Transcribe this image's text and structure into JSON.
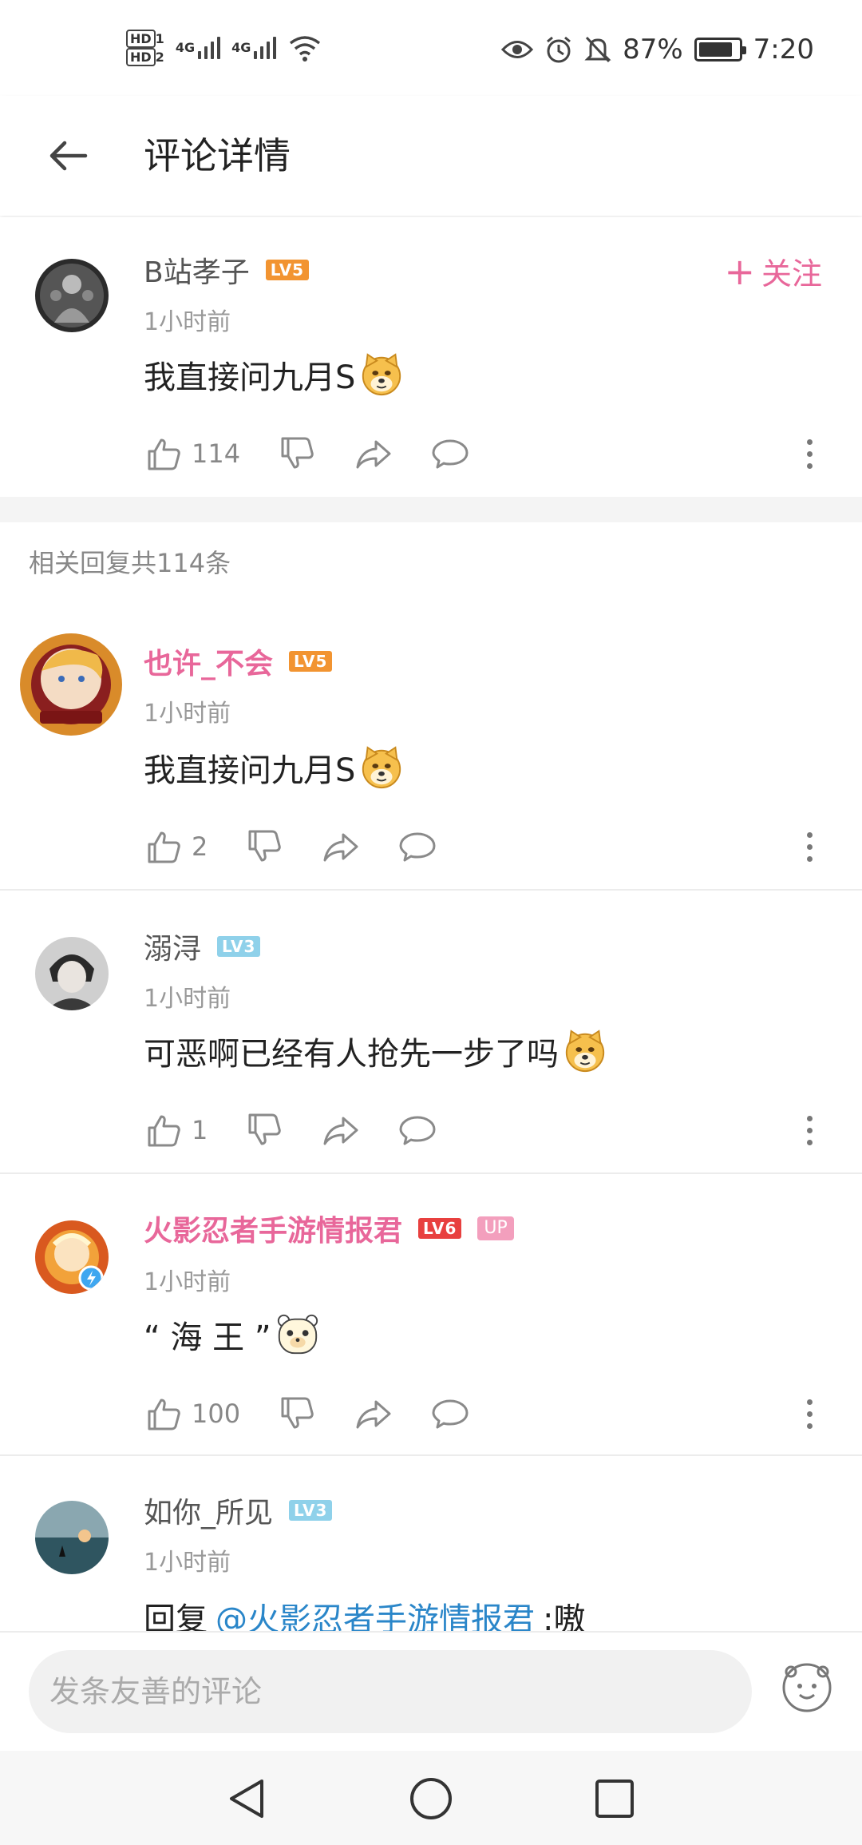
{
  "status_bar": {
    "hd1": "HD",
    "hd1_sub": "1",
    "hd2": "HD",
    "hd2_sub": "2",
    "net1": "4G",
    "net2": "4G",
    "battery_pct": "87%",
    "battery_level": 0.87,
    "time": "7:20"
  },
  "header": {
    "title": "评论详情"
  },
  "main_comment": {
    "username": "B站孝子",
    "level": "LV5",
    "time": "1小时前",
    "text": "我直接问九月S",
    "likes": "114",
    "follow_label": "关注",
    "follow_plus": "+"
  },
  "replies": {
    "count_label": "相关回复共114条",
    "items": [
      {
        "username": "也许_不会",
        "level": "LV5",
        "time": "1小时前",
        "text": "我直接问九月S",
        "likes": "2"
      },
      {
        "username": "溺浔",
        "level": "LV3",
        "time": "1小时前",
        "text": "可恶啊已经有人抢先一步了吗",
        "likes": "1"
      },
      {
        "username": "火影忍者手游情报君",
        "level": "LV6",
        "badge": "UP",
        "time": "1小时前",
        "text": "“ 海 王 ”",
        "likes": "100"
      },
      {
        "username": "如你_所见",
        "level": "LV3",
        "time": "1小时前",
        "text_prefix": "回复",
        "mention": "@火影忍者手游情报君",
        "text_suffix": ":嗷"
      }
    ]
  },
  "input": {
    "placeholder": "发条友善的评论"
  },
  "colors": {
    "pink": "#e8679a",
    "lv5": "#f29431",
    "lv3": "#8fd1ea",
    "lv6": "#e8403f",
    "mention": "#2a86c9"
  },
  "icons": [
    "back-arrow-icon",
    "like-icon",
    "dislike-icon",
    "share-icon",
    "reply-icon",
    "more-icon",
    "doge-emoji-icon",
    "emoji-icon",
    "nav-back-icon",
    "nav-home-icon",
    "nav-recent-icon",
    "eye-icon",
    "alarm-icon",
    "mute-icon",
    "wifi-icon",
    "battery-icon"
  ]
}
